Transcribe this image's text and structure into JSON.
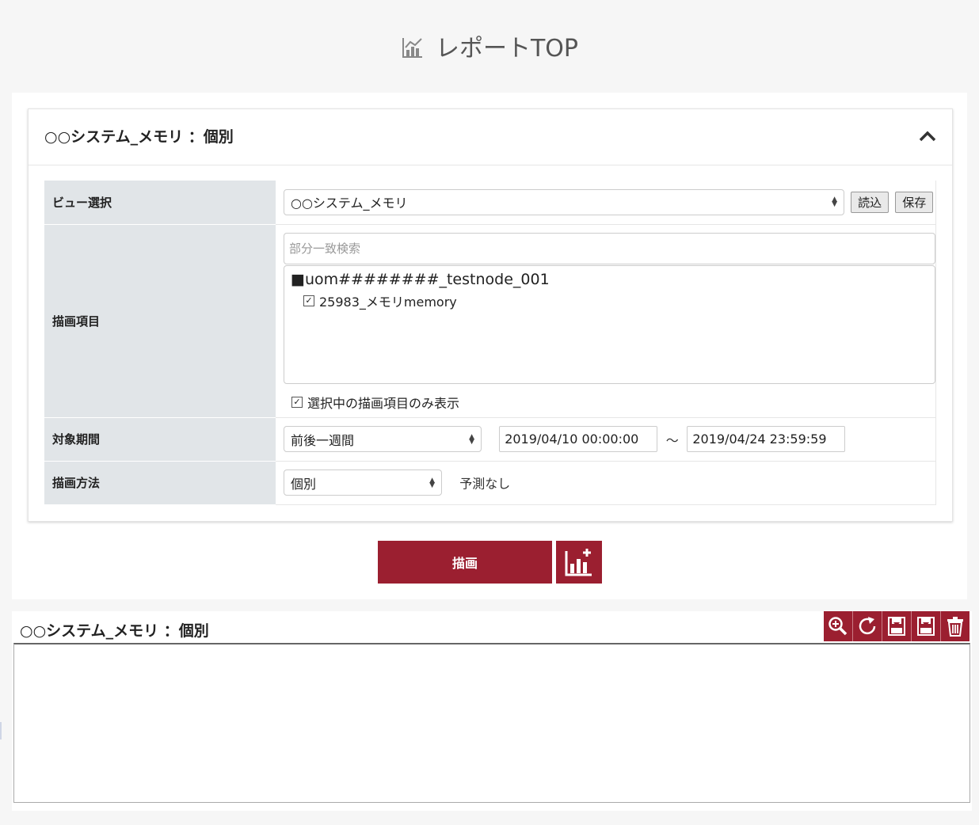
{
  "page": {
    "title": "レポートTOP"
  },
  "panel": {
    "title": "○○システム_メモリ ：個別",
    "rows": {
      "view": {
        "label": "ビュー選択",
        "selected": "○○システム_メモリ",
        "load_label": "読込",
        "save_label": "保存"
      },
      "items": {
        "label": "描画項目",
        "search_placeholder": "部分一致検索",
        "node": "■uom########_testnode_001",
        "leaf": "25983_メモリmemory",
        "only_selected_label": "選択中の描画項目のみ表示"
      },
      "period": {
        "label": "対象期間",
        "selected": "前後一週間",
        "start": "2019/04/10 00:00:00",
        "separator": "～",
        "end": "2019/04/24 23:59:59"
      },
      "method": {
        "label": "描画方法",
        "selected": "個別",
        "forecast": "予測なし"
      }
    }
  },
  "actions": {
    "draw_label": "描画"
  },
  "graph": {
    "title": "○○システム_メモリ ：個別"
  },
  "colors": {
    "accent": "#9b1f30",
    "header_bg": "#e1e5e8",
    "page_bg": "#f6f6f6"
  },
  "icons": {
    "title": "chart-icon",
    "collapse": "chevron-up-icon",
    "add_graph": "add-chart-icon",
    "toolbar": [
      "zoom-in-icon",
      "refresh-icon",
      "csv-download-icon",
      "png-download-icon",
      "trash-icon"
    ]
  }
}
